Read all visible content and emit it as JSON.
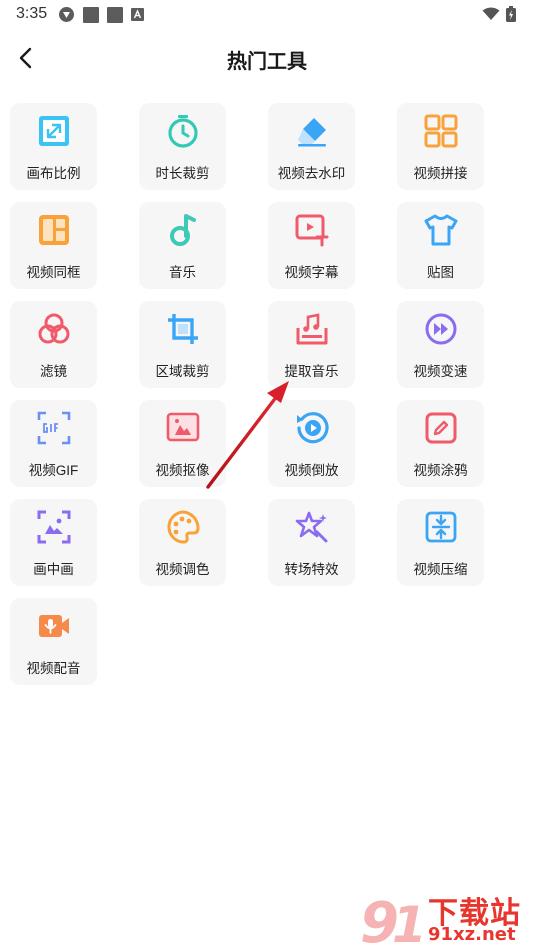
{
  "status": {
    "time": "3:35"
  },
  "header": {
    "title": "热门工具",
    "back_icon": "chevron-left-icon"
  },
  "tools": [
    {
      "label": "画布比例",
      "icon": "canvas-ratio-icon",
      "color": "#3cc3f5"
    },
    {
      "label": "时长裁剪",
      "icon": "timer-icon",
      "color": "#34c9b7"
    },
    {
      "label": "视频去水印",
      "icon": "eraser-icon",
      "color": "#3aa5f5"
    },
    {
      "label": "视频拼接",
      "icon": "grid-join-icon",
      "color": "#f8a23a"
    },
    {
      "label": "视频同框",
      "icon": "split-frame-icon",
      "color": "#f8a23a"
    },
    {
      "label": "音乐",
      "icon": "music-note-icon",
      "color": "#3cc9b5"
    },
    {
      "label": "视频字幕",
      "icon": "subtitle-icon",
      "color": "#f05a6a"
    },
    {
      "label": "贴图",
      "icon": "tshirt-icon",
      "color": "#3aa5f5"
    },
    {
      "label": "滤镜",
      "icon": "filter-circles-icon",
      "color": "#f05a6a"
    },
    {
      "label": "区域裁剪",
      "icon": "crop-icon",
      "color": "#3aa5f5"
    },
    {
      "label": "提取音乐",
      "icon": "extract-music-icon",
      "color": "#f05a6a"
    },
    {
      "label": "视频变速",
      "icon": "fast-forward-icon",
      "color": "#8b6cf0"
    },
    {
      "label": "视频GIF",
      "icon": "gif-icon",
      "color": "#6b8ff5"
    },
    {
      "label": "视频抠像",
      "icon": "portrait-cutout-icon",
      "color": "#f05a6a"
    },
    {
      "label": "视频倒放",
      "icon": "reverse-play-icon",
      "color": "#3aa5f5"
    },
    {
      "label": "视频涂鸦",
      "icon": "doodle-pen-icon",
      "color": "#f05a6a"
    },
    {
      "label": "画中画",
      "icon": "picture-in-picture-icon",
      "color": "#8b6cf0"
    },
    {
      "label": "视频调色",
      "icon": "palette-icon",
      "color": "#f8a23a"
    },
    {
      "label": "转场特效",
      "icon": "transition-star-icon",
      "color": "#8b6cf0"
    },
    {
      "label": "视频压缩",
      "icon": "compress-icon",
      "color": "#3aa5f5"
    },
    {
      "label": "视频配音",
      "icon": "dubbing-mic-icon",
      "color": "#f58a4a"
    }
  ],
  "watermark": {
    "top": "下载站",
    "bottom": "91xz.net"
  }
}
